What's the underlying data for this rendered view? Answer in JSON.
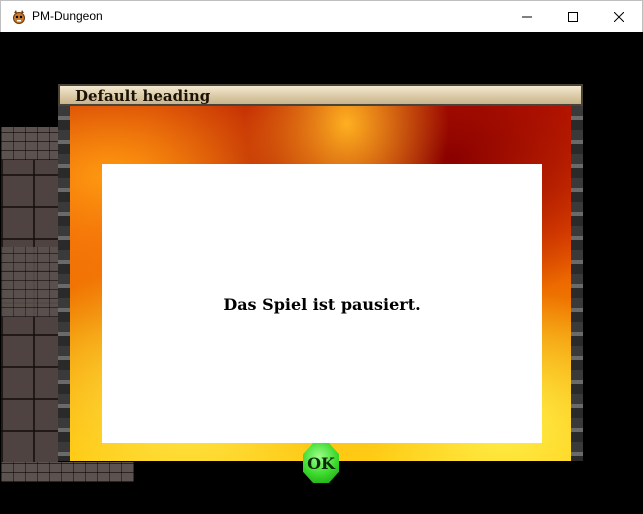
{
  "window": {
    "title": "PM-Dungeon",
    "icon": "app-icon",
    "controls": [
      "minimize-icon",
      "maximize-icon",
      "close-icon"
    ]
  },
  "dialog": {
    "heading": "Default heading",
    "message": "Das Spiel ist pausiert.",
    "ok_label": "OK"
  },
  "colors": {
    "header_bg": "#d9c8a3",
    "panel_bg": "#ffffff",
    "ok_button": "#3ad82a",
    "background": "#000000"
  }
}
